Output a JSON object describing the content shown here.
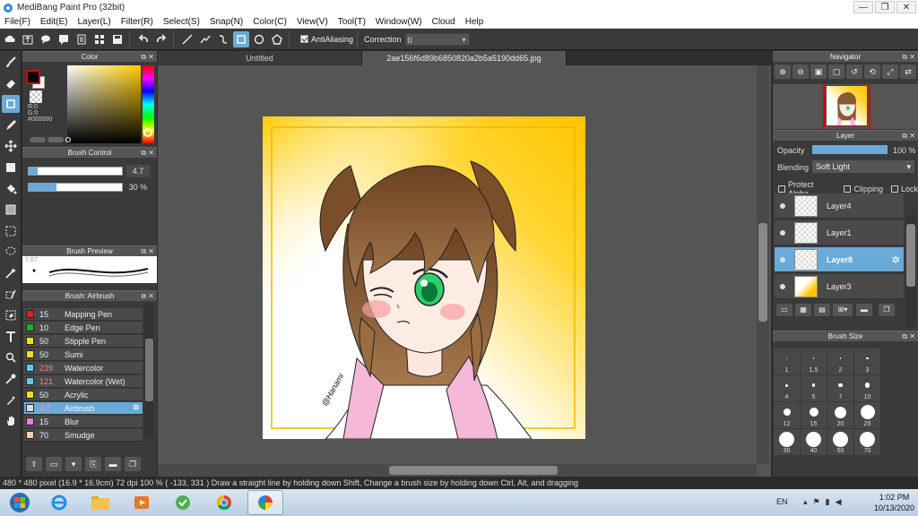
{
  "window": {
    "title": "MediBang Paint Pro (32bit)",
    "min": "—",
    "restore": "❐",
    "close": "✕"
  },
  "menu": [
    "File(F)",
    "Edit(E)",
    "Layer(L)",
    "Filter(R)",
    "Select(S)",
    "Snap(N)",
    "Color(C)",
    "View(V)",
    "Tool(T)",
    "Window(W)",
    "Cloud",
    "Help"
  ],
  "toolbar": {
    "antialias_label": "AntiAliasing",
    "correction_label": "Correction",
    "correction_value": "0"
  },
  "panels": {
    "color_title": "Color",
    "rgb_r": "R:0",
    "rgb_g": "G:0",
    "rgb_hex": "#000000",
    "brush_control_title": "Brush Control",
    "brush_size_value": "4.7",
    "brush_size_fraction": 0.1,
    "opacity_value": "30 %",
    "opacity_fraction": 0.3,
    "brush_preview_title": "Brush Preview",
    "brush_preview_size": "1.67",
    "brush_list_title": "Brush: Airbrush",
    "navigator_title": "Navigator",
    "layer_title": "Layer",
    "layer_opacity_label": "Opacity",
    "layer_opacity_value": "100 %",
    "layer_opacity_fraction": 1.0,
    "blending_label": "Blending",
    "blending_value": "Soft Light",
    "protect_alpha": "Protect Alpha",
    "clipping": "Clipping",
    "lock": "Lock",
    "brush_size_title": "Brush Size"
  },
  "brushes": [
    {
      "size": "15",
      "name": "Mapping Pen",
      "color": "#e02020"
    },
    {
      "size": "10",
      "name": "Edge Pen",
      "color": "#20b020"
    },
    {
      "size": "50",
      "name": "Stipple Pen",
      "color": "#f0e020"
    },
    {
      "size": "50",
      "name": "Sumi",
      "color": "#f0e020"
    },
    {
      "size": "239",
      "name": "Watercolor",
      "color": "#60c8f0"
    },
    {
      "size": "121",
      "name": "Watercolor (Wet)",
      "color": "#60c8f0"
    },
    {
      "size": "50",
      "name": "Acrylic",
      "color": "#f0e020"
    },
    {
      "size": "4.7",
      "name": "Airbrush",
      "color": "#dddddd",
      "selected": true
    },
    {
      "size": "15",
      "name": "Blur",
      "color": "#e080e0"
    },
    {
      "size": "70",
      "name": "Smudge",
      "color": "#f0d0b0"
    }
  ],
  "tabs": [
    "Untitled",
    "2ae156f6d89b6850820a2b5a5190dd65.jpg"
  ],
  "layers": [
    {
      "name": "Layer4"
    },
    {
      "name": "Layer1"
    },
    {
      "name": "Layer8",
      "selected": true
    },
    {
      "name": "Layer3"
    }
  ],
  "brush_sizes": [
    "1",
    "1.5",
    "2",
    "3",
    "4",
    "5",
    "7",
    "10",
    "12",
    "15",
    "20",
    "25",
    "30",
    "40",
    "50",
    "70"
  ],
  "status": {
    "size": "480 * 480 pixel",
    "physical": "(16.9 * 16.9cm)",
    "dpi": "72 dpi",
    "zoom": "100 %",
    "coords": "( -133, 331 )",
    "hint": "Draw a straight line by holding down Shift, Change a brush size by holding down Ctrl, Alt, and dragging"
  },
  "signature": "@Hanami",
  "taskbar": {
    "lang": "EN",
    "time": "1:02 PM",
    "date": "10/13/2020"
  }
}
